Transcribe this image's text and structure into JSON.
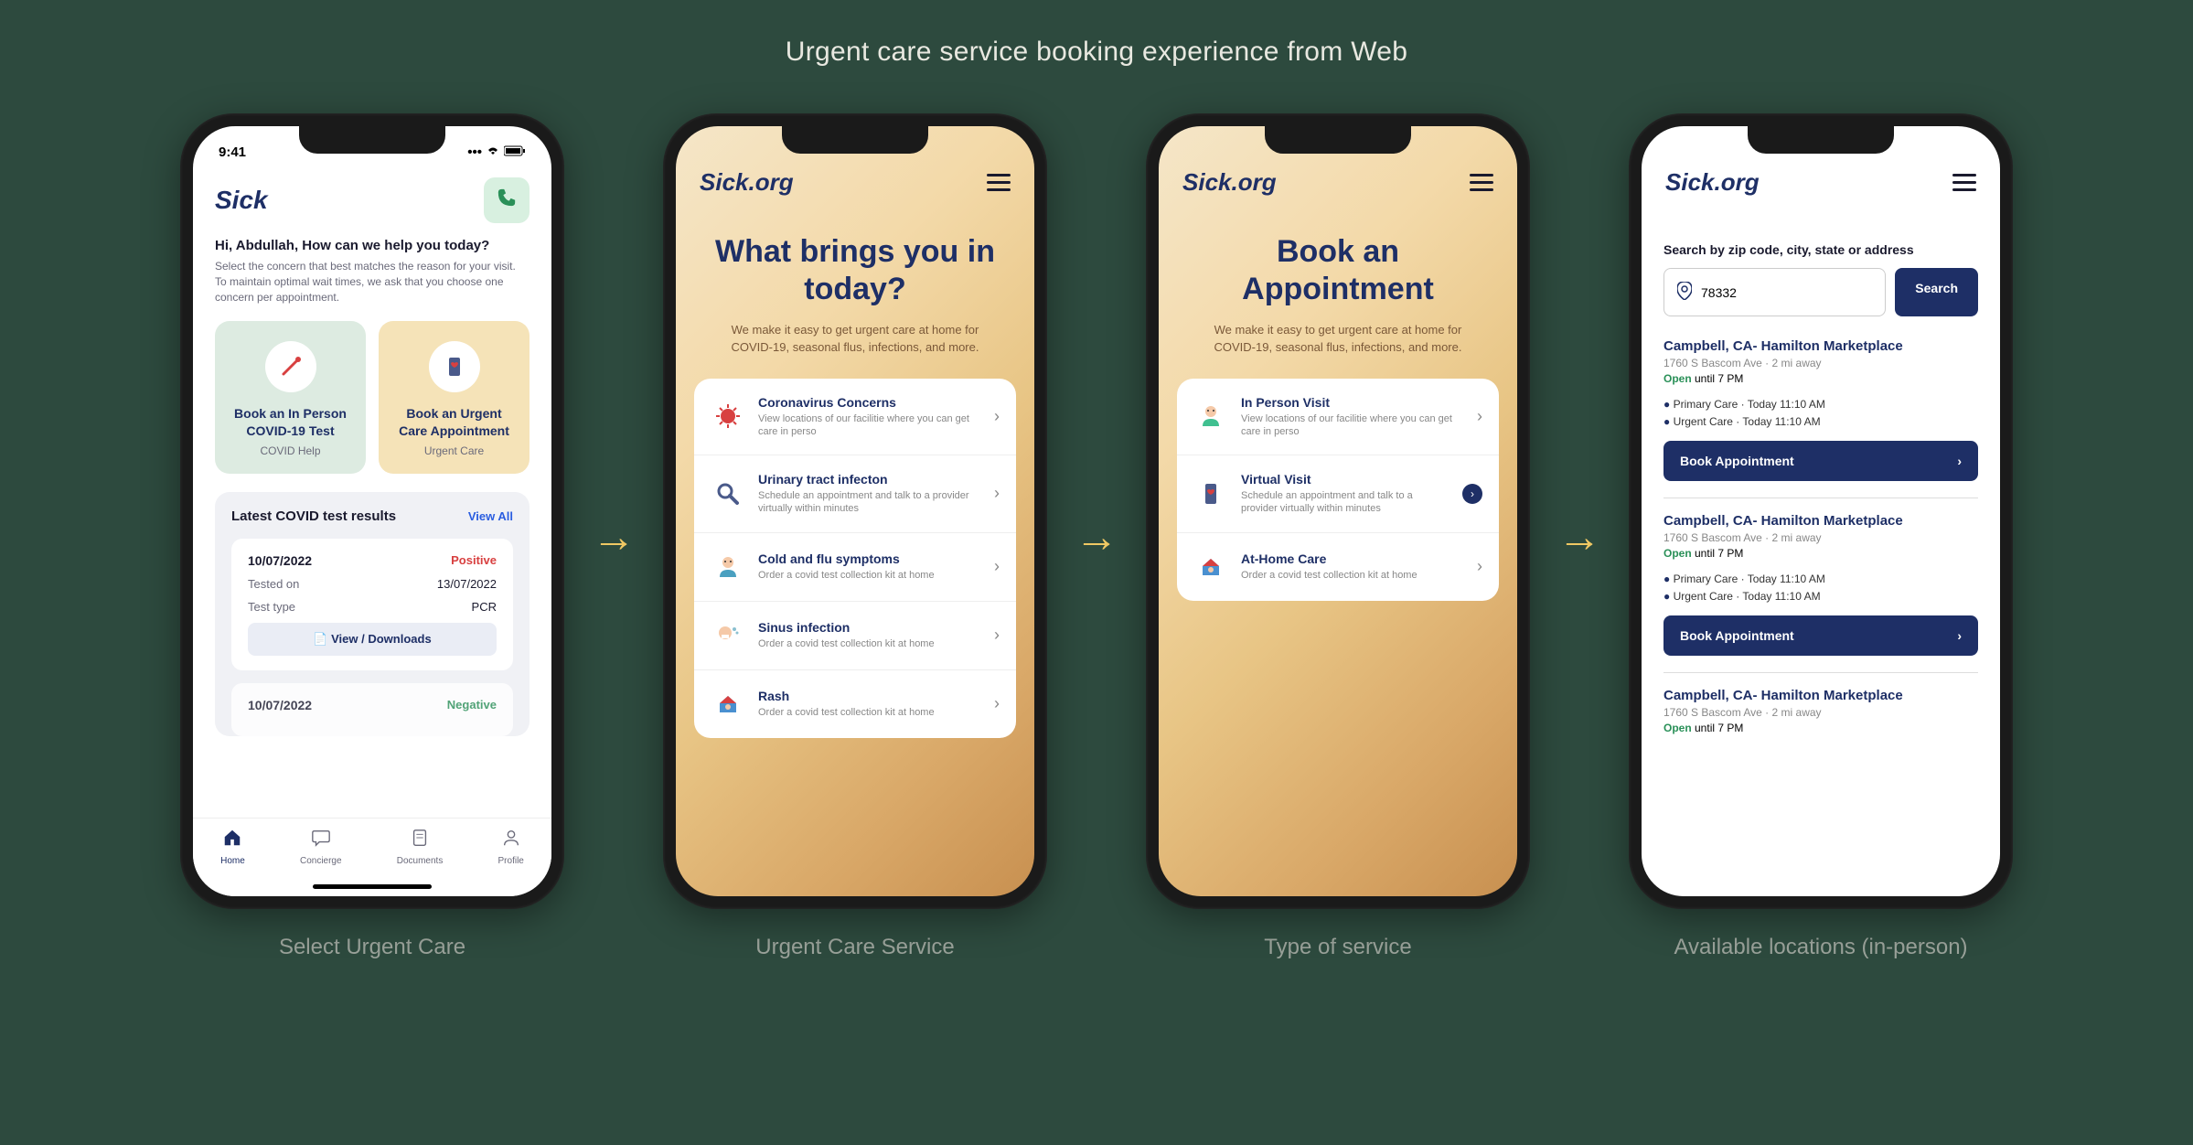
{
  "page_title": "Urgent care service booking experience from Web",
  "captions": [
    "Select Urgent Care",
    "Urgent Care Service",
    "Type of service",
    "Available locations (in-person)"
  ],
  "status_time": "9:41",
  "phone1": {
    "logo": "Sick",
    "greeting": "Hi, Abdullah, How can we help you today?",
    "subtext": "Select the concern that best matches the reason for your visit. To maintain optimal wait times, we ask that you choose one concern per appointment.",
    "tiles": [
      {
        "title": "Book an In Person COVID-19 Test",
        "sub": "COVID Help"
      },
      {
        "title": "Book an Urgent Care Appointment",
        "sub": "Urgent Care"
      }
    ],
    "card_title": "Latest COVID test results",
    "view_all": "View All",
    "results": [
      {
        "date": "10/07/2022",
        "status": "Positive",
        "tested_label": "Tested on",
        "tested": "13/07/2022",
        "type_label": "Test type",
        "type": "PCR",
        "dl": "View / Downloads"
      },
      {
        "date": "10/07/2022",
        "status": "Negative"
      }
    ],
    "tabs": [
      "Home",
      "Concierge",
      "Documents",
      "Profile"
    ]
  },
  "phone2": {
    "logo": "Sick.org",
    "title": "What brings you in today?",
    "sub": "We make it easy to get urgent care at home for COVID-19, seasonal flus, infections, and more.",
    "items": [
      {
        "title": "Coronavirus Concerns",
        "desc": "View locations of our facilitie where you can get care in perso"
      },
      {
        "title": "Urinary tract infecton",
        "desc": "Schedule an appointment and talk to a provider virtually within minutes"
      },
      {
        "title": "Cold and flu symptoms",
        "desc": "Order a covid test collection kit at home"
      },
      {
        "title": "Sinus infection",
        "desc": "Order a covid test collection kit at home"
      },
      {
        "title": "Rash",
        "desc": "Order a covid test collection kit at home"
      }
    ]
  },
  "phone3": {
    "logo": "Sick.org",
    "title": "Book an Appointment",
    "sub": "We make it easy to get urgent care at home for COVID-19, seasonal flus, infections, and more.",
    "items": [
      {
        "title": "In Person Visit",
        "desc": "View locations of our facilitie where you can get care in perso"
      },
      {
        "title": "Virtual Visit",
        "desc": "Schedule an appointment and talk to a provider virtually within minutes"
      },
      {
        "title": "At-Home Care",
        "desc": "Order a covid test collection kit at home"
      }
    ]
  },
  "phone4": {
    "logo": "Sick.org",
    "search_label": "Search by zip code, city, state or address",
    "search_value": "78332",
    "search_btn": "Search",
    "locations": [
      {
        "name": "Campbell, CA- Hamilton Marketplace",
        "addr": "1760 S Bascom Ave · 2 mi away",
        "open_word": "Open",
        "open_rest": " until 7 PM",
        "times": [
          "Primary Care · Today 11:10 AM",
          "Urgent Care · Today 11:10 AM"
        ],
        "book": "Book Appointment"
      },
      {
        "name": "Campbell, CA- Hamilton Marketplace",
        "addr": "1760 S Bascom Ave · 2 mi away",
        "open_word": "Open",
        "open_rest": " until 7 PM",
        "times": [
          "Primary Care · Today 11:10 AM",
          "Urgent Care · Today 11:10 AM"
        ],
        "book": "Book Appointment"
      },
      {
        "name": "Campbell, CA- Hamilton Marketplace",
        "addr": "1760 S Bascom Ave · 2 mi away",
        "open_word": "Open",
        "open_rest": " until 7 PM"
      }
    ]
  }
}
